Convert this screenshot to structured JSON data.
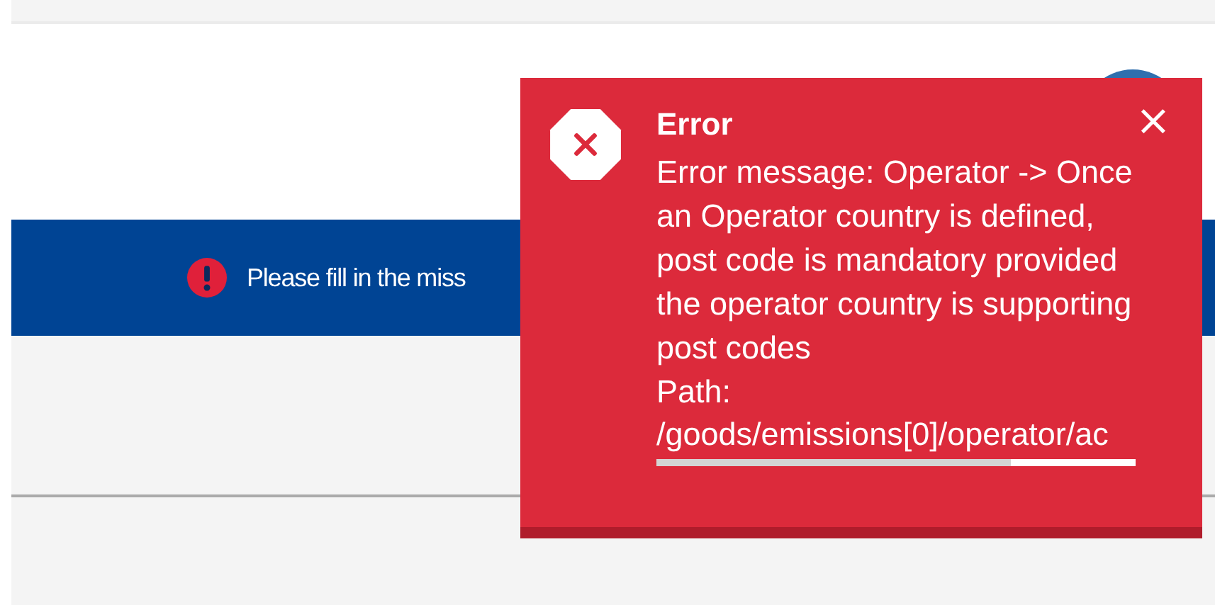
{
  "banner": {
    "text": "Please fill in the miss"
  },
  "toast": {
    "title": "Error",
    "message": "Error message: Operator -> Once an Operator country is defined, post code is mandatory provided the operator country is supporting post codes",
    "path_label": "Path:",
    "path": "/goods/emissions[0]/operator/ac",
    "close": "×"
  }
}
